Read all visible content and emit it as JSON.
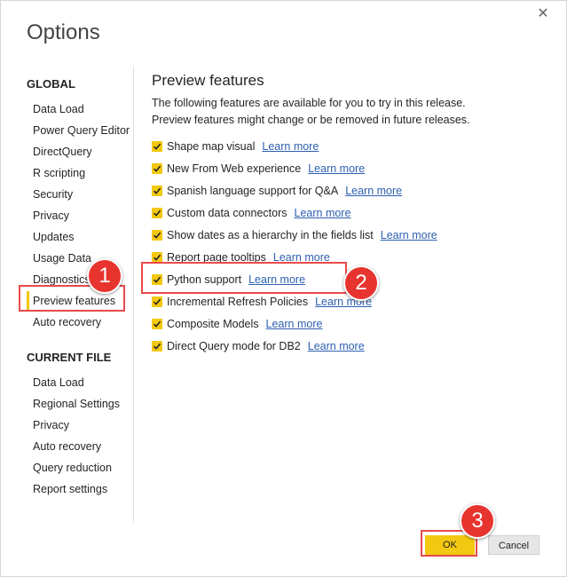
{
  "dialog": {
    "title": "Options",
    "close_glyph": "✕"
  },
  "sidebar": {
    "global_heading": "GLOBAL",
    "global_items": [
      {
        "label": "Data Load"
      },
      {
        "label": "Power Query Editor"
      },
      {
        "label": "DirectQuery"
      },
      {
        "label": "R scripting"
      },
      {
        "label": "Security"
      },
      {
        "label": "Privacy"
      },
      {
        "label": "Updates"
      },
      {
        "label": "Usage Data"
      },
      {
        "label": "Diagnostics"
      },
      {
        "label": "Preview features",
        "selected": true
      },
      {
        "label": "Auto recovery"
      }
    ],
    "current_heading": "CURRENT FILE",
    "current_items": [
      {
        "label": "Data Load"
      },
      {
        "label": "Regional Settings"
      },
      {
        "label": "Privacy"
      },
      {
        "label": "Auto recovery"
      },
      {
        "label": "Query reduction"
      },
      {
        "label": "Report settings"
      }
    ]
  },
  "main": {
    "title": "Preview features",
    "description": "The following features are available for you to try in this release. Preview features might change or be removed in future releases.",
    "link_text": "Learn more",
    "features": [
      {
        "label": "Shape map visual",
        "checked": true
      },
      {
        "label": "New From Web experience",
        "checked": true
      },
      {
        "label": "Spanish language support for Q&A",
        "checked": true
      },
      {
        "label": "Custom data connectors",
        "checked": true
      },
      {
        "label": "Show dates as a hierarchy in the fields list",
        "checked": true
      },
      {
        "label": "Report page tooltips",
        "checked": true
      },
      {
        "label": "Python support",
        "checked": true
      },
      {
        "label": "Incremental Refresh Policies",
        "checked": true
      },
      {
        "label": "Composite Models",
        "checked": true
      },
      {
        "label": "Direct Query mode for DB2",
        "checked": true
      }
    ]
  },
  "footer": {
    "ok_label": "OK",
    "cancel_label": "Cancel"
  },
  "annotations": {
    "step1": "1",
    "step2": "2",
    "step3": "3"
  },
  "colors": {
    "accent_yellow": "#f2c811",
    "highlight_red": "#e84a4a",
    "badge_red": "#e8342f",
    "link_blue": "#2d5fb0"
  }
}
